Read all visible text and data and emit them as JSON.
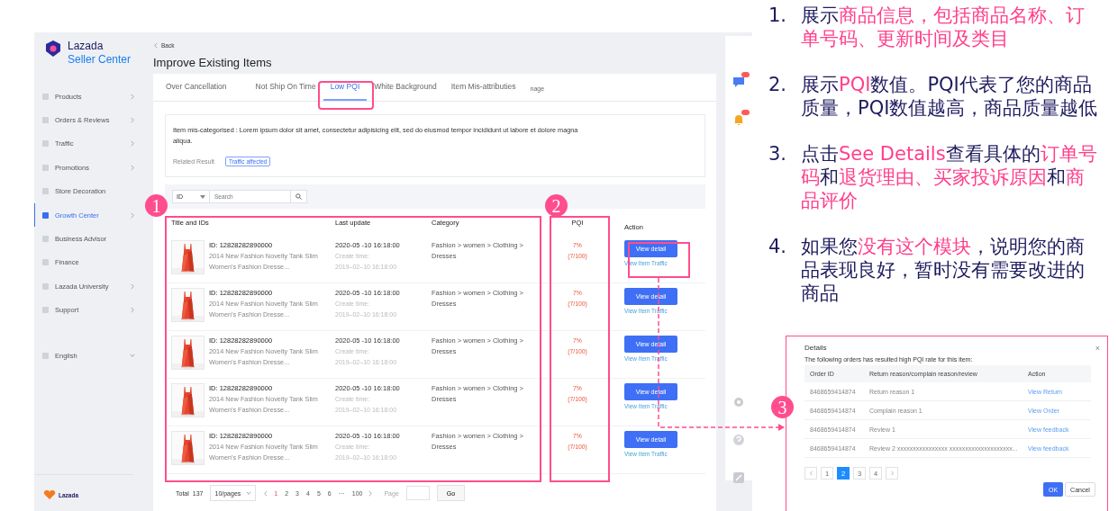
{
  "sidebar": {
    "logo_line1": "Lazada",
    "logo_line2": "Seller Center",
    "items": [
      {
        "label": "Products",
        "selected": false,
        "has_submenu": true
      },
      {
        "label": "Orders & Reviews",
        "selected": false,
        "has_submenu": true
      },
      {
        "label": "Traffic",
        "selected": false,
        "has_submenu": true
      },
      {
        "label": "Promotions",
        "selected": false,
        "has_submenu": true
      },
      {
        "label": "Store Decoration",
        "selected": false,
        "has_submenu": false
      },
      {
        "label": "Growth Center",
        "selected": true,
        "has_submenu": true
      },
      {
        "label": "Business Advisor",
        "selected": false,
        "has_submenu": false
      },
      {
        "label": "Finance",
        "selected": false,
        "has_submenu": false
      },
      {
        "label": "Lazada University",
        "selected": false,
        "has_submenu": true
      },
      {
        "label": "Support",
        "selected": false,
        "has_submenu": true
      }
    ],
    "language": "English",
    "footer_logo": "Lazada"
  },
  "header": {
    "back": "Back",
    "title": "Improve Existing Items"
  },
  "tabs": [
    {
      "label": "Over Cancellation",
      "selected": false
    },
    {
      "label": "Not Ship On Time",
      "selected": false
    },
    {
      "label": "Low PQI",
      "selected": true
    },
    {
      "label": "White Background",
      "selected": false
    },
    {
      "label": "Item Mis-attributies",
      "selected": false
    },
    {
      "label": "nage",
      "selected": false
    }
  ],
  "description": {
    "text": "Item mis-categorised : Lorem ipsum dolor sit amet, consectetur adipisicing elit, sed do eiusmod tempor incididunt ut labore et dolore magna aliqua.",
    "related_label": "Related Result",
    "tag": "Traffic affected"
  },
  "search": {
    "filter": "ID",
    "placeholder": "Search"
  },
  "table": {
    "columns": [
      "Title and IDs",
      "Last update",
      "Category",
      "PQI",
      "Action"
    ],
    "rows": [
      {
        "id": "ID: 12828282890000",
        "title": "2014 New Fashion Novelty Tank Slim Women's Fashion Dresse...",
        "updated": "2020-05 -10  16:18:00",
        "create_label": "Create time:",
        "created": "2019–02–10  16:18:00",
        "category": "Fashion > women > Clothing > Dresses",
        "pqi": "7%",
        "pqi_ratio": "(7/100)",
        "action": "View detail",
        "link": "View Item Traffic"
      },
      {
        "id": "ID: 12828282890000",
        "title": "2014 New Fashion Novelty Tank Slim Women's Fashion Dresse...",
        "updated": "2020-05 -10  16:18:00",
        "create_label": "Create time:",
        "created": "2019–02–10  16:18:00",
        "category": "Fashion > women > Clothing > Dresses",
        "pqi": "7%",
        "pqi_ratio": "(7/100)",
        "action": "View detail",
        "link": "View Item Traffic"
      },
      {
        "id": "ID: 12828282890000",
        "title": "2014 New Fashion Novelty Tank Slim Women's Fashion Dresse...",
        "updated": "2020-05 -10  16:18:00",
        "create_label": "Create time:",
        "created": "2019–02–10  16:18:00",
        "category": "Fashion > women > Clothing > Dresses",
        "pqi": "7%",
        "pqi_ratio": "(7/100)",
        "action": "View detail",
        "link": "View Item Traffic"
      },
      {
        "id": "ID: 12828282890000",
        "title": "2014 New Fashion Novelty Tank Slim Women's Fashion Dresse...",
        "updated": "2020-05 -10  16:18:00",
        "create_label": "Create time:",
        "created": "2019–02–10  16:18:00",
        "category": "Fashion > women > Clothing > Dresses",
        "pqi": "7%",
        "pqi_ratio": "(7/100)",
        "action": "View detail",
        "link": "View Item Traffic"
      },
      {
        "id": "ID: 12828282890000",
        "title": "2014 New Fashion Novelty Tank Slim Women's Fashion Dresse...",
        "updated": "2020-05 -10  16:18:00",
        "create_label": "Create time:",
        "created": "2019–02–10  16:18:00",
        "category": "Fashion > women > Clothing > Dresses",
        "pqi": "7%",
        "pqi_ratio": "(7/100)",
        "action": "View detail",
        "link": "View Item Traffic"
      }
    ]
  },
  "pagination": {
    "total_label": "Total",
    "total": "137",
    "page_size": "10/pages",
    "pages": [
      {
        "label": "1",
        "selected": true
      },
      {
        "label": "2",
        "selected": false
      },
      {
        "label": "3",
        "selected": false
      },
      {
        "label": "4",
        "selected": false
      },
      {
        "label": "5",
        "selected": false
      },
      {
        "label": "6",
        "selected": false
      },
      {
        "label": "···",
        "selected": false
      },
      {
        "label": "100",
        "selected": false
      }
    ],
    "page_label": "Page",
    "go": "Go"
  },
  "callouts": [
    {
      "label": "1"
    },
    {
      "label": "2"
    },
    {
      "label": "3"
    }
  ],
  "notes": [
    {
      "number": "1.",
      "text": "展示**商品信息，包括商品名称、订单号码、更新时间及类目**"
    },
    {
      "number": "2.",
      "text": "展示**PQI**数值。PQI代表了您的商品质量，PQI数值越高，商品质量越低"
    },
    {
      "number": "3.",
      "text": "点击**See Details**查看具体的**订单号码**和**退货理由、买家投诉原因**和**商品评价**"
    },
    {
      "number": "4.",
      "text": "如果您**没有这个模块**，说明您的商品表现良好，暂时没有需要改进的商品"
    }
  ],
  "dialog": {
    "title": "Details",
    "close": "×",
    "subtitle": "The following orders has resulted high PQI rate for this item:",
    "columns": [
      "Order ID",
      "Return reason/complain reason/review",
      "Action"
    ],
    "rows": [
      {
        "order": "8468659414874",
        "reason": "Return reason 1",
        "action": "View Return"
      },
      {
        "order": "8468659414874",
        "reason": "Complain reason 1",
        "action": "View Order"
      },
      {
        "order": "8468659414874",
        "reason": "Review 1",
        "action": "View feedback"
      },
      {
        "order": "8468659414874",
        "reason": "Review 2 xxxxxxxxxxxxxxxx xxxxxxxxxxxxxxxxxxxx...",
        "action": "View feedback"
      }
    ],
    "pages": [
      {
        "label": "1",
        "selected": false
      },
      {
        "label": "2",
        "selected": true
      },
      {
        "label": "3",
        "selected": false
      },
      {
        "label": "4",
        "selected": false
      }
    ],
    "ok": "OK",
    "cancel": "Cancel"
  }
}
